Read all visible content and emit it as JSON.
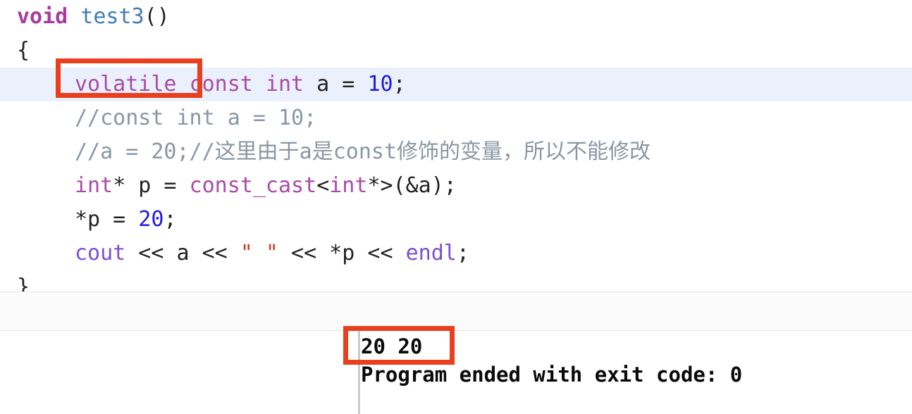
{
  "editor": {
    "language": "cpp",
    "highlighted_line_index": 2,
    "highlight_color": "#eaf1fd",
    "lines": [
      {
        "indent": 0,
        "tokens": [
          {
            "text": "void",
            "kind": "keyword"
          },
          {
            "text": " ",
            "kind": "plain"
          },
          {
            "text": "test3",
            "kind": "function"
          },
          {
            "text": "()",
            "kind": "plain"
          }
        ]
      },
      {
        "indent": 0,
        "tokens": [
          {
            "text": "{",
            "kind": "plain"
          }
        ]
      },
      {
        "indent": 1,
        "tokens": [
          {
            "text": "volatile",
            "kind": "type"
          },
          {
            "text": " ",
            "kind": "plain"
          },
          {
            "text": "const",
            "kind": "type"
          },
          {
            "text": " ",
            "kind": "plain"
          },
          {
            "text": "int",
            "kind": "type"
          },
          {
            "text": " a = ",
            "kind": "plain"
          },
          {
            "text": "10",
            "kind": "number"
          },
          {
            "text": ";",
            "kind": "plain"
          }
        ]
      },
      {
        "indent": 1,
        "tokens": [
          {
            "text": "//const int a = 10;",
            "kind": "comment"
          }
        ]
      },
      {
        "indent": 1,
        "tokens": [
          {
            "text": "//a = 20;//这里由于a是const修饰的变量，所以不能修改",
            "kind": "comment"
          }
        ]
      },
      {
        "indent": 1,
        "tokens": [
          {
            "text": "int",
            "kind": "type"
          },
          {
            "text": "* p = ",
            "kind": "plain"
          },
          {
            "text": "const_cast",
            "kind": "type"
          },
          {
            "text": "<",
            "kind": "plain"
          },
          {
            "text": "int",
            "kind": "type"
          },
          {
            "text": "*>(&a);",
            "kind": "plain"
          }
        ]
      },
      {
        "indent": 1,
        "tokens": [
          {
            "text": "*p = ",
            "kind": "plain"
          },
          {
            "text": "20",
            "kind": "number"
          },
          {
            "text": ";",
            "kind": "plain"
          }
        ]
      },
      {
        "indent": 1,
        "tokens": [
          {
            "text": "cout",
            "kind": "stream"
          },
          {
            "text": " << a << ",
            "kind": "plain"
          },
          {
            "text": "\" \"",
            "kind": "string"
          },
          {
            "text": " << *p << ",
            "kind": "plain"
          },
          {
            "text": "endl",
            "kind": "stream"
          },
          {
            "text": ";",
            "kind": "plain"
          }
        ]
      },
      {
        "indent": 0,
        "tokens": [
          {
            "text": "}",
            "kind": "plain"
          }
        ]
      }
    ]
  },
  "console": {
    "lines": [
      "20 20",
      "Program ended with exit code: 0"
    ]
  },
  "annotations": [
    {
      "id": "annot-volatile",
      "label": "volatile-keyword-highlight-box",
      "target_text": "volatile",
      "color": "#ea3f1d"
    },
    {
      "id": "annot-output",
      "label": "console-output-highlight-box",
      "target_text": "20 20",
      "color": "#ea3f1d"
    }
  ],
  "colors": {
    "background": "#ffffff",
    "keyword": "#a83ba0",
    "type": "#ab4aa6",
    "function": "#3f7cb4",
    "number": "#1f1ae0",
    "string": "#cf3a22",
    "stream": "#7a4fd6",
    "plain": "#222222",
    "comment": "#8a97a4",
    "line_highlight": "#eaf1fd",
    "annotation": "#ea3f1d",
    "separator": "#e3e3e5",
    "console_gutter": "#c9c9c9"
  }
}
